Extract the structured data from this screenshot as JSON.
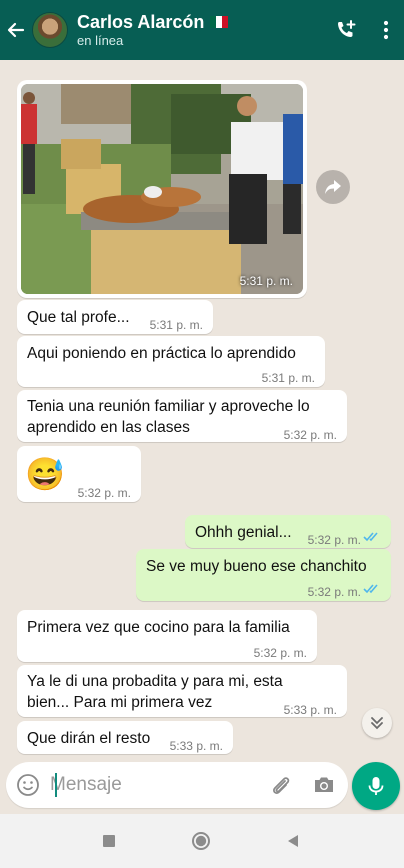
{
  "header": {
    "contact_name": "Carlos Alarcón",
    "status": "en línea",
    "flag": "mexico-flag",
    "colors": {
      "bar": "#075e54"
    }
  },
  "messages": [
    {
      "type": "image",
      "direction": "in",
      "time": "5:31 p. m."
    },
    {
      "type": "text",
      "direction": "in",
      "text": "Que tal profe...",
      "time": "5:31 p. m."
    },
    {
      "type": "text",
      "direction": "in",
      "text": "Aqui poniendo en práctica lo aprendido",
      "time": "5:31 p. m."
    },
    {
      "type": "text",
      "direction": "in",
      "line1": "Tenia una reunión familiar y aproveche lo",
      "line2": "aprendido en las clases",
      "time": "5:32 p. m."
    },
    {
      "type": "emoji",
      "direction": "in",
      "emoji": "😅",
      "time": "5:32 p. m."
    },
    {
      "type": "text",
      "direction": "out",
      "text": "Ohhh genial...",
      "time": "5:32 p. m.",
      "ticks": "✓✓"
    },
    {
      "type": "text",
      "direction": "out",
      "text": "Se ve muy bueno ese chanchito",
      "time": "5:32 p. m.",
      "ticks": "✓✓"
    },
    {
      "type": "text",
      "direction": "in",
      "text": "Primera vez que cocino para la familia",
      "time": "5:32 p. m."
    },
    {
      "type": "text",
      "direction": "in",
      "line1": "Ya le di una probadita y para mi, esta",
      "line2": "bien... Para mi primera vez",
      "time": "5:33 p. m."
    },
    {
      "type": "text",
      "direction": "in",
      "text": "Que dirán el resto",
      "time": "5:33 p. m."
    }
  ],
  "composer": {
    "placeholder": "Mensaje",
    "value": ""
  },
  "colors": {
    "incoming": "#ffffff",
    "outgoing": "#dcf8c6",
    "read_ticks": "#4fb6ec",
    "mic": "#00a884",
    "background": "#ece5dd"
  }
}
